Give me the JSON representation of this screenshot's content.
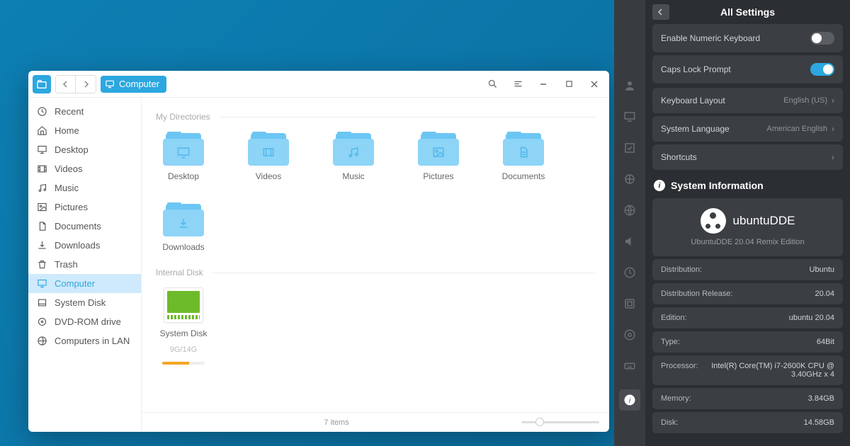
{
  "file_manager": {
    "location": "Computer",
    "sidebar": {
      "items": [
        {
          "label": "Recent",
          "icon": "clock"
        },
        {
          "label": "Home",
          "icon": "home"
        },
        {
          "label": "Desktop",
          "icon": "desktop"
        },
        {
          "label": "Videos",
          "icon": "video"
        },
        {
          "label": "Music",
          "icon": "music"
        },
        {
          "label": "Pictures",
          "icon": "picture"
        },
        {
          "label": "Documents",
          "icon": "document"
        },
        {
          "label": "Downloads",
          "icon": "download"
        },
        {
          "label": "Trash",
          "icon": "trash"
        },
        {
          "label": "Computer",
          "icon": "computer",
          "active": true
        },
        {
          "label": "System Disk",
          "icon": "disk"
        },
        {
          "label": "DVD-ROM drive",
          "icon": "dvd"
        },
        {
          "label": "Computers in LAN",
          "icon": "network"
        }
      ]
    },
    "sections": {
      "my_directories": {
        "title": "My Directories",
        "items": [
          {
            "label": "Desktop",
            "glyph": "desktop"
          },
          {
            "label": "Videos",
            "glyph": "video"
          },
          {
            "label": "Music",
            "glyph": "music"
          },
          {
            "label": "Pictures",
            "glyph": "picture"
          },
          {
            "label": "Documents",
            "glyph": "document"
          },
          {
            "label": "Downloads",
            "glyph": "download"
          }
        ]
      },
      "internal_disk": {
        "title": "Internal Disk",
        "items": [
          {
            "label": "System Disk",
            "size": "9G/14G",
            "usage_pct": 64
          }
        ]
      }
    },
    "status": {
      "count": "7 items"
    }
  },
  "settings": {
    "title": "All Settings",
    "toggles": [
      {
        "label": "Enable Numeric Keyboard",
        "on": false
      },
      {
        "label": "Caps Lock Prompt",
        "on": true
      }
    ],
    "rows": [
      {
        "label": "Keyboard Layout",
        "value": "English (US)"
      },
      {
        "label": "System Language",
        "value": "American English"
      },
      {
        "label": "Shortcuts",
        "value": ""
      }
    ],
    "sysinfo": {
      "heading": "System Information",
      "brand": "ubuntuDDE",
      "subtitle": "UbuntuDDE 20.04 Remix Edition",
      "items": [
        {
          "k": "Distribution:",
          "v": "Ubuntu"
        },
        {
          "k": "Distribution Release:",
          "v": "20.04"
        },
        {
          "k": "Edition:",
          "v": "ubuntu 20.04"
        },
        {
          "k": "Type:",
          "v": "64Bit"
        },
        {
          "k": "Processor:",
          "v": "Intel(R) Core(TM) i7-2600K CPU @ 3.40GHz x 4"
        },
        {
          "k": "Memory:",
          "v": "3.84GB"
        },
        {
          "k": "Disk:",
          "v": "14.58GB"
        }
      ]
    }
  }
}
